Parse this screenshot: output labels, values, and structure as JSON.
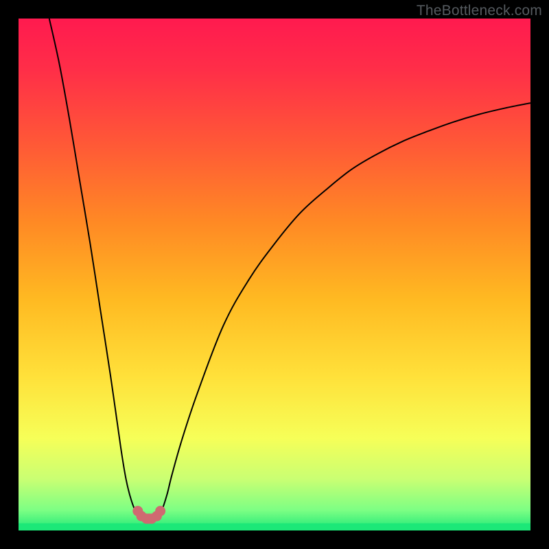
{
  "watermark": "TheBottleneck.com",
  "colors": {
    "black": "#000000",
    "curve": "#000000",
    "dots": "#cf6a71",
    "gradient_stops": [
      {
        "offset": 0.0,
        "color": "#ff1a4f"
      },
      {
        "offset": 0.1,
        "color": "#ff2e48"
      },
      {
        "offset": 0.25,
        "color": "#ff5a36"
      },
      {
        "offset": 0.4,
        "color": "#ff8a24"
      },
      {
        "offset": 0.55,
        "color": "#ffba22"
      },
      {
        "offset": 0.7,
        "color": "#ffe13a"
      },
      {
        "offset": 0.82,
        "color": "#f6ff58"
      },
      {
        "offset": 0.9,
        "color": "#c9ff73"
      },
      {
        "offset": 0.96,
        "color": "#7DFF84"
      },
      {
        "offset": 1.0,
        "color": "#1CE878"
      }
    ]
  },
  "chart_data": {
    "type": "line",
    "title": "",
    "xlabel": "",
    "ylabel": "",
    "xlim": [
      0,
      100
    ],
    "ylim": [
      0,
      100
    ],
    "grid": false,
    "legend": false,
    "series": [
      {
        "name": "left-branch",
        "x": [
          6,
          8,
          10,
          12,
          14,
          16,
          18,
          20,
          21,
          22,
          23,
          24
        ],
        "y": [
          100,
          91,
          80,
          68,
          56,
          43,
          30,
          16,
          10,
          6,
          3.5,
          2.5
        ]
      },
      {
        "name": "right-branch",
        "x": [
          27,
          28,
          29,
          30,
          32,
          35,
          40,
          45,
          50,
          55,
          60,
          65,
          70,
          75,
          80,
          85,
          90,
          95,
          100
        ],
        "y": [
          2.5,
          4,
          7,
          11,
          18,
          27,
          40,
          49,
          56,
          62,
          66.5,
          70.5,
          73.5,
          76,
          78,
          79.8,
          81.3,
          82.5,
          83.5
        ]
      }
    ],
    "marker_series": {
      "name": "trough-dots",
      "x": [
        23.3,
        24.0,
        25.0,
        25.5,
        26.0,
        27.0,
        27.7
      ],
      "y": [
        3.8,
        2.8,
        2.3,
        2.3,
        2.3,
        2.8,
        3.8
      ]
    },
    "green_baseline_y": 1.4
  }
}
